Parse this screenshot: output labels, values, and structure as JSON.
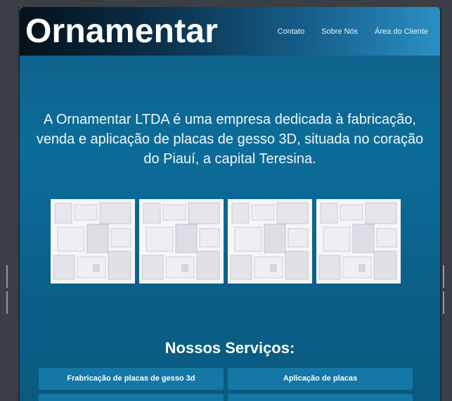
{
  "site": {
    "logo": "Ornamentar"
  },
  "nav": {
    "items": [
      "Contato",
      "Sobre Nós",
      "Área do Cliente"
    ]
  },
  "intro": {
    "text": "A Ornamentar LTDA é uma empresa dedicada à fabricação, venda e aplicação de placas de gesso 3D, situada no coração do Piauí, a capital Teresina."
  },
  "gallery": {
    "count": 4
  },
  "services": {
    "title": "Nossos Serviços:",
    "items": [
      "Frabricação de placas de gesso 3d",
      "Aplicação de placas",
      "",
      ""
    ]
  },
  "colors": {
    "header_start": "#05111b",
    "header_end": "#2b8fc3",
    "page_bg": "#0c6c99",
    "service_btn": "#1477a6"
  }
}
